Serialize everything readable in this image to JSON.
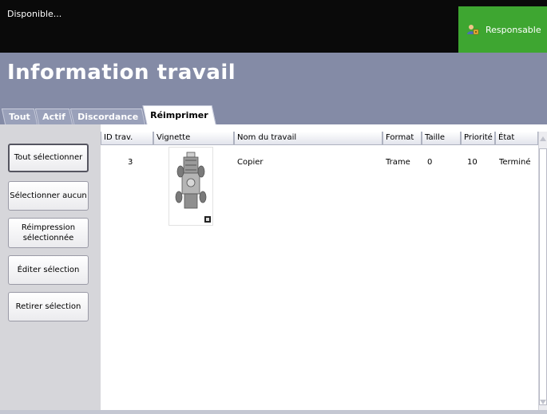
{
  "status": {
    "text": "Disponible..."
  },
  "role": {
    "label": "Responsable",
    "icon": "user-key-icon",
    "color": "#3ea631"
  },
  "header": {
    "title": "Information travail",
    "background": "#848ba6"
  },
  "tabs": [
    {
      "label": "Tout",
      "active": false
    },
    {
      "label": "Actif",
      "active": false
    },
    {
      "label": "Discordance",
      "active": false
    },
    {
      "label": "Réimprimer",
      "active": true
    }
  ],
  "sidebar": {
    "select_all": "Tout sélectionner",
    "select_none": "Sélectionner aucun",
    "reprint_selected": "Réimpression\nsélectionnée",
    "edit_selection": "Éditer sélection",
    "remove_selection": "Retirer sélection"
  },
  "table": {
    "columns": [
      "ID trav.",
      "Vignette",
      "Nom du travail",
      "Format",
      "Taille",
      "Priorité",
      "État"
    ],
    "rows": [
      {
        "id": "3",
        "thumbnail": "car-thumbnail",
        "name": "Copier",
        "format": "Trame",
        "size": "0",
        "priority": "10",
        "state": "Terminé"
      }
    ]
  }
}
